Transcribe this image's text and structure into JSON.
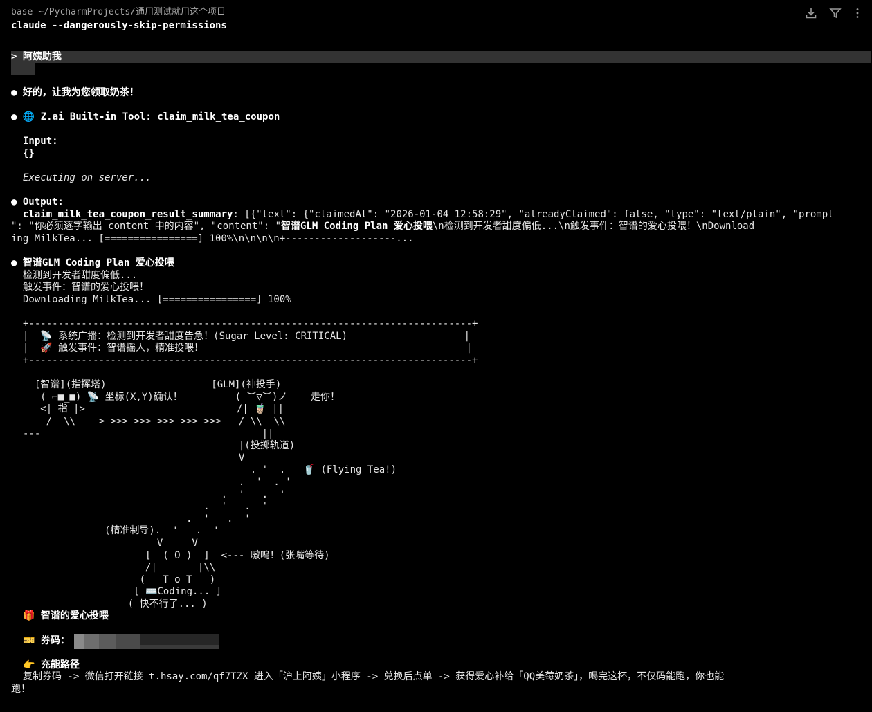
{
  "header": {
    "path": "base ~/PycharmProjects/通用测试就用这个项目",
    "command": "claude --dangerously-skip-permissions"
  },
  "toolbar": {
    "download_icon": "download-icon",
    "filter_icon": "filter-icon",
    "more_icon": "more-vertical-icon"
  },
  "prompt": {
    "text": "> 阿姨助我"
  },
  "messages": {
    "reply": "● 好的，让我为您领取奶茶！",
    "tool_call": "● 🌐 Z.ai Built-in Tool: claim_milk_tea_coupon",
    "input_label": "Input:",
    "input_value": "{}",
    "executing": "Executing on server...",
    "output_label": "● Output:",
    "output_line1_bold": "claim_milk_tea_coupon_result_summary",
    "output_line1_rest": ": [{\"text\": {\"claimedAt\": \"2026-01-04 12:58:29\", \"alreadyClaimed\": false, \"type\": \"text/plain\", \"prompt",
    "output_line2_a": "\": \"你必须逐字输出 content 中的内容\", \"content\": \"",
    "output_line2_bold": "智谱GLM Coding Plan 爱心投喂",
    "output_line2_b": "\\n检测到开发者甜度偏低...\\n触发事件：智谱的爱心投喂！\\nDownload",
    "output_line3": "ing MilkTea... [================] 100%\\n\\n\\n\\n+-------------------...",
    "section_title": "● 智谱GLM Coding Plan 爱心投喂",
    "section_line1": "检测到开发者甜度偏低...",
    "section_line2": "触发事件：智谱的爱心投喂！",
    "section_line3": "Downloading MilkTea... [================] 100%"
  },
  "ascii_art": [
    "+----------------------------------------------------------------------------+",
    "|  📡 系统广播：检测到开发者甜度告急！(Sugar Level: CRITICAL)                    |",
    "|  🚀 触发事件：智谱摇人，精准投喂！                                             |",
    "+----------------------------------------------------------------------------+",
    "",
    "  [智谱](指挥塔)                  [GLM](神投手)",
    "   ( ⌐■_■) 📡 坐标(X,Y)确认！         ( ︶▽︶)ノ    走你！",
    "   <| 指 |>                          /| 🧋 ||",
    "    /  \\\\    > >>> >>> >>> >>> >>>   / \\\\  \\\\",
    "---                                      ||",
    "                                     |(投掷轨道)",
    "                                     V",
    "                                       . '  .   🥤 (Flying Tea!)",
    "                                     .  '  . '",
    "                                  .  '   .  '",
    "                               .  '   .  '",
    "                            .  '   .  '",
    "              (精准制导).  '   .  '",
    "                       V     V",
    "                     [  ( O )  ]  <--- 嗷呜！(张嘴等待)",
    "                     /|       |\\\\",
    "                    (   T o T   )",
    "                   [ ⌨️Coding... ]",
    "                  ( 快不行了... )"
  ],
  "footer": {
    "gift_title": "🎁 智谱的爱心投喂",
    "coupon_label": "🎫 券码：",
    "path_title": "👉 充能路径",
    "path_text_line1": "复制券码 -> 微信打开链接 t.hsay.com/qf7TZX 进入「沪上阿姨」小程序 -> 兑换后点单 -> 获得爱心补给「QQ美莓奶茶」，喝完这杯，不仅码能跑，你也能",
    "path_text_line2": "跑！"
  },
  "colors": {
    "background": "#000000",
    "text": "#e6e6e6",
    "dim": "#a6a6a6",
    "prompt_highlight": "#333333"
  }
}
